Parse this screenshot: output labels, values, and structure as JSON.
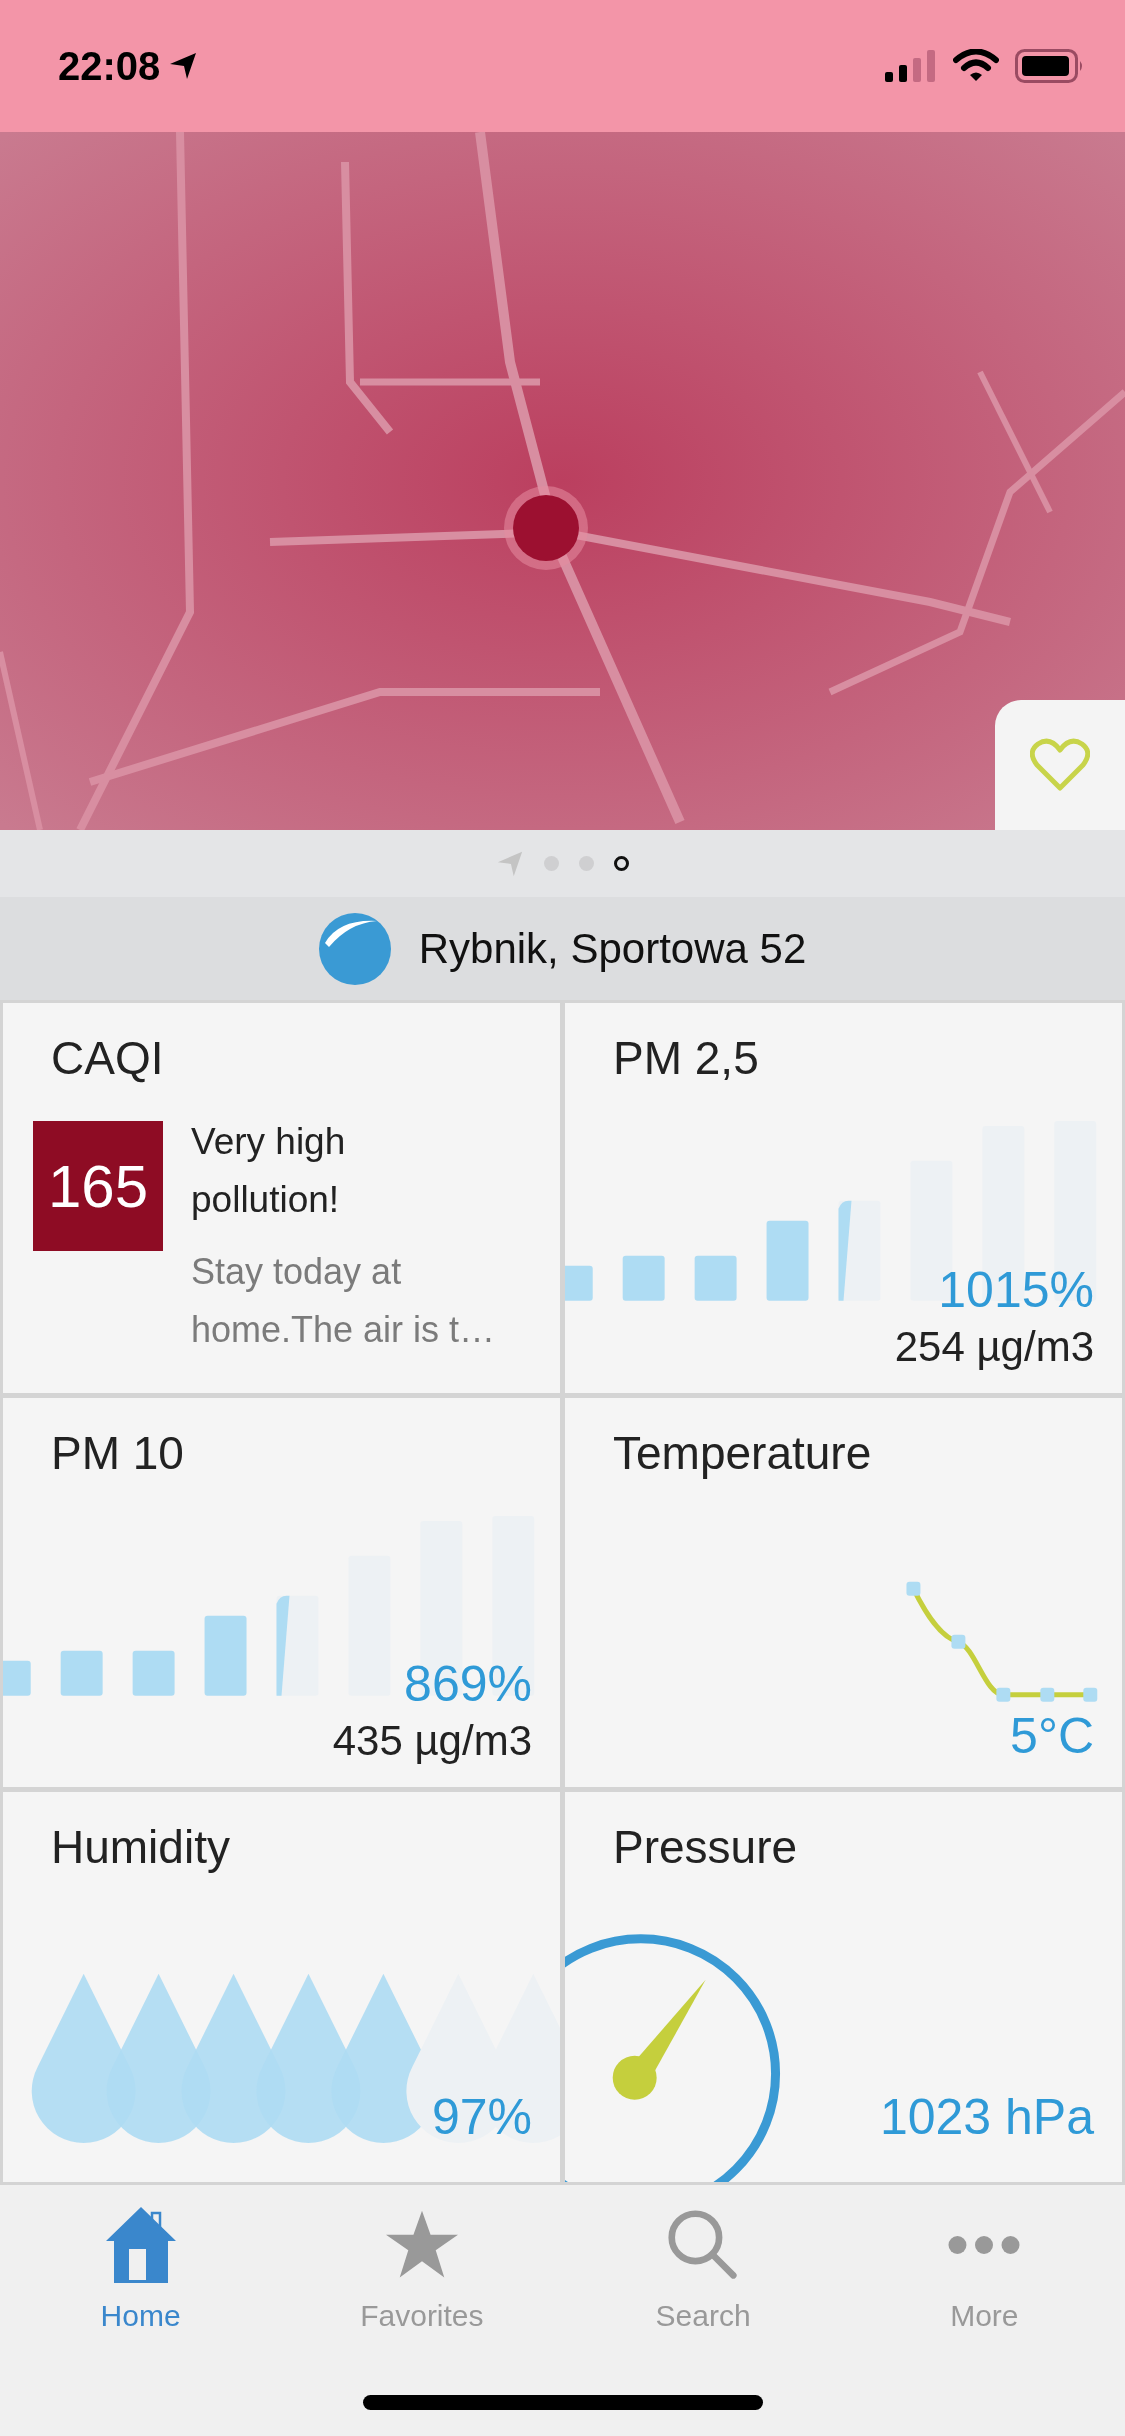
{
  "status_bar": {
    "time": "22:08"
  },
  "pager": [
    {
      "kind": "location",
      "selected": false
    },
    {
      "kind": "dot",
      "selected": false
    },
    {
      "kind": "dot",
      "selected": false
    },
    {
      "kind": "dot",
      "selected": true
    }
  ],
  "location": {
    "name": "Rybnik, Sportowa 52"
  },
  "cards": [
    {
      "kind": "caqi",
      "title": "CAQI",
      "index": "165",
      "color": "#8e0c24",
      "headline": "Very high pollution!",
      "description": "Stay today at home.The air is t…"
    },
    {
      "kind": "bars",
      "title": "PM 2,5",
      "percent": "1015%",
      "concentration": "254 µg/m3"
    },
    {
      "kind": "bars",
      "title": "PM 10",
      "percent": "869%",
      "concentration": "435 µg/m3"
    },
    {
      "kind": "line",
      "title": "Temperature",
      "value": "5°C"
    },
    {
      "kind": "drops",
      "title": "Humidity",
      "value": "97%"
    },
    {
      "kind": "gauge",
      "title": "Pressure",
      "value": "1023 hPa"
    }
  ],
  "tabs": [
    {
      "kind": "home",
      "label": "Home",
      "selected": true
    },
    {
      "kind": "star",
      "label": "Favorites",
      "selected": false
    },
    {
      "kind": "search",
      "label": "Search",
      "selected": false
    },
    {
      "kind": "more",
      "label": "More",
      "selected": false
    }
  ]
}
